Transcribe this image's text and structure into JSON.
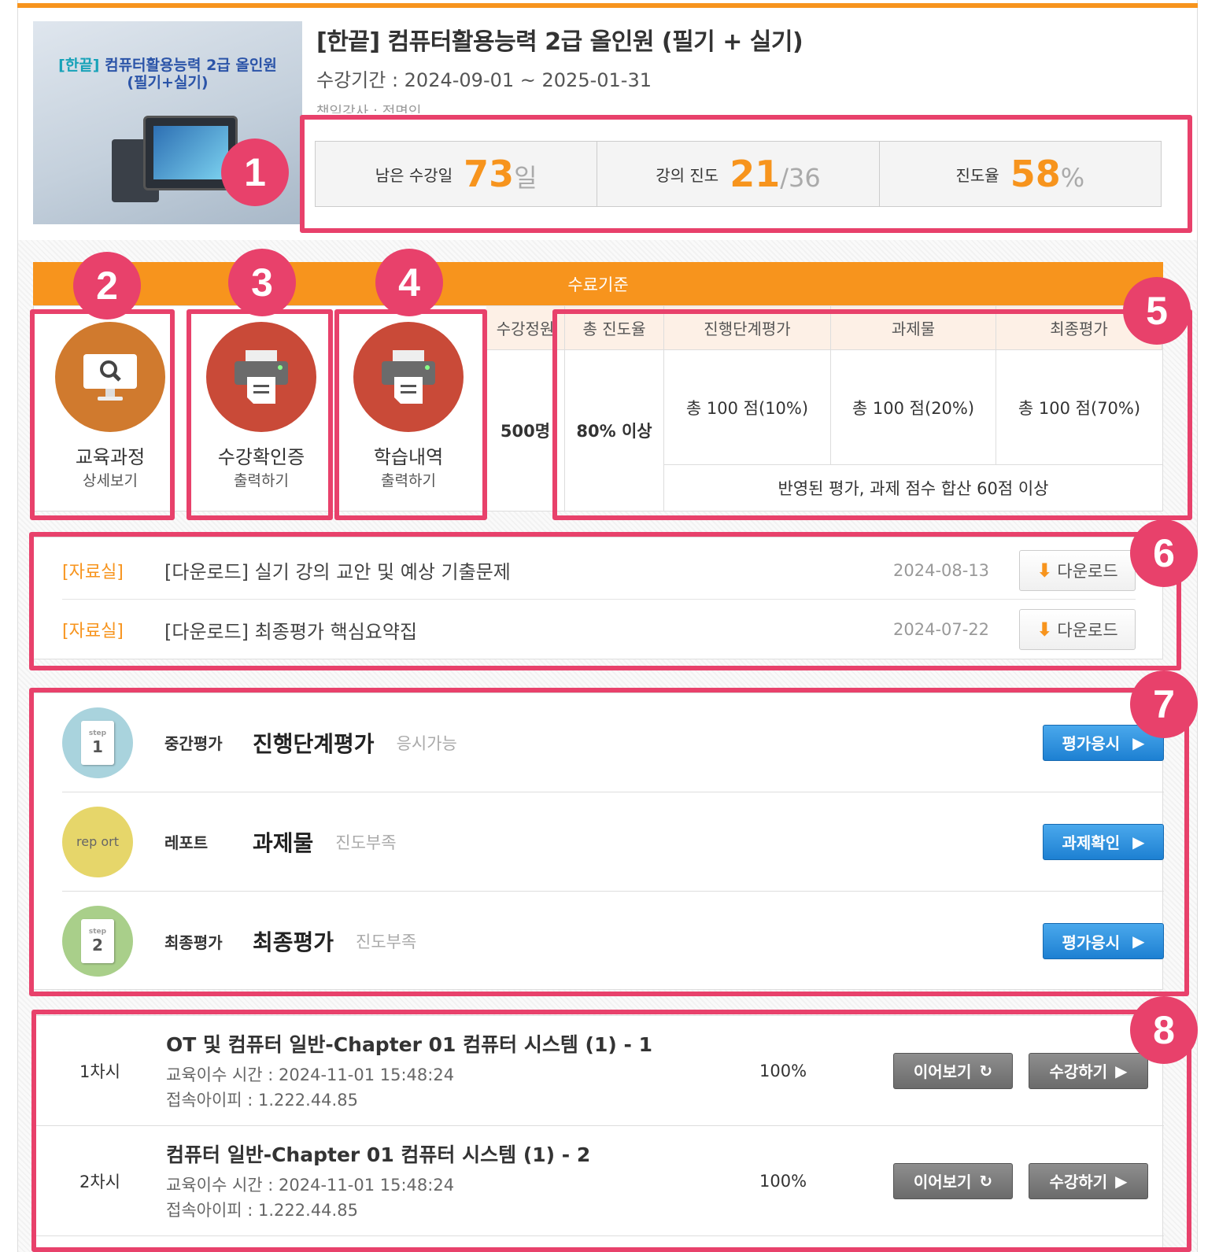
{
  "course": {
    "thumb_title_line1_prefix": "[한끝]",
    "thumb_title_line1_rest": " 컴퓨터활용능력 2급 올인원",
    "thumb_title_line2": "(필기+실기)",
    "title": "[한끝] 컴퓨터활용능력 2급 올인원 (필기 + 실기)",
    "period": "수강기간 : 2024-09-01 ~ 2025-01-31",
    "teacher": "책임강사 : 전면인"
  },
  "stats": [
    {
      "label": "남은 수강일",
      "value": "73",
      "unit": "일"
    },
    {
      "label": "강의 진도",
      "value": "21",
      "unit": "/36"
    },
    {
      "label": "진도율",
      "value": "58",
      "unit": "%"
    }
  ],
  "badges": [
    "1",
    "2",
    "3",
    "4",
    "5",
    "6",
    "7",
    "8"
  ],
  "completion": {
    "header": "수료기준",
    "actions": [
      {
        "line1": "교육과정",
        "line2": "상세보기",
        "icon": "monitor-search-icon",
        "color": "#d07a2e"
      },
      {
        "line1": "수강확인증",
        "line2": "출력하기",
        "icon": "printer-icon",
        "color": "#c94a38"
      },
      {
        "line1": "학습내역",
        "line2": "출력하기",
        "icon": "printer-icon",
        "color": "#c94a38"
      }
    ],
    "columns": [
      "수강정원",
      "총 진도율",
      "진행단계평가",
      "과제물",
      "최종평가"
    ],
    "capacity": "500명",
    "min_progress": "80% 이상",
    "scores": [
      "총 100 점(10%)",
      "총 100 점(20%)",
      "총 100 점(70%)"
    ],
    "sum_rule": "반영된 평가, 과제 점수 합산 60점 이상"
  },
  "resources": [
    {
      "category": "[자료실]",
      "title": "[다운로드] 실기 강의 교안 및 예상 기출문제",
      "date": "2024-08-13",
      "button": "다운로드"
    },
    {
      "category": "[자료실]",
      "title": "[다운로드] 최종평가 핵심요약집",
      "date": "2024-07-22",
      "button": "다운로드"
    }
  ],
  "evaluations": [
    {
      "type": "중간평가",
      "name": "진행단계평가",
      "status": "응시가능",
      "button": "평가응시",
      "icon_text": "1",
      "icon_small": "step",
      "icon_color": "#a9d3dd"
    },
    {
      "type": "레포트",
      "name": "과제물",
      "status": "진도부족",
      "button": "과제확인",
      "icon_text": "rep  ort",
      "icon_small": "",
      "icon_color": "#e6d66a"
    },
    {
      "type": "최종평가",
      "name": "최종평가",
      "status": "진도부족",
      "button": "평가응시",
      "icon_text": "2",
      "icon_small": "step",
      "icon_color": "#a9cf8a"
    }
  ],
  "lessons": [
    {
      "no": "1차시",
      "title": "OT 및 컴퓨터 일반-Chapter 01 컴퓨터 시스템 (1) - 1",
      "time": "교육이수 시간 : 2024-11-01 15:48:24",
      "ip": "접속아이피 : 1.222.44.85",
      "progress": "100%",
      "resume": "이어보기",
      "start": "수강하기"
    },
    {
      "no": "2차시",
      "title": "컴퓨터 일반-Chapter 01 컴퓨터 시스템 (1) - 2",
      "time": "교육이수 시간 : 2024-11-01 15:48:24",
      "ip": "접속아이피 : 1.222.44.85",
      "progress": "100%",
      "resume": "이어보기",
      "start": "수강하기"
    }
  ],
  "colors": {
    "accent": "#f7941d",
    "highlight": "#e8416b",
    "button_blue": "#1d80d2"
  }
}
